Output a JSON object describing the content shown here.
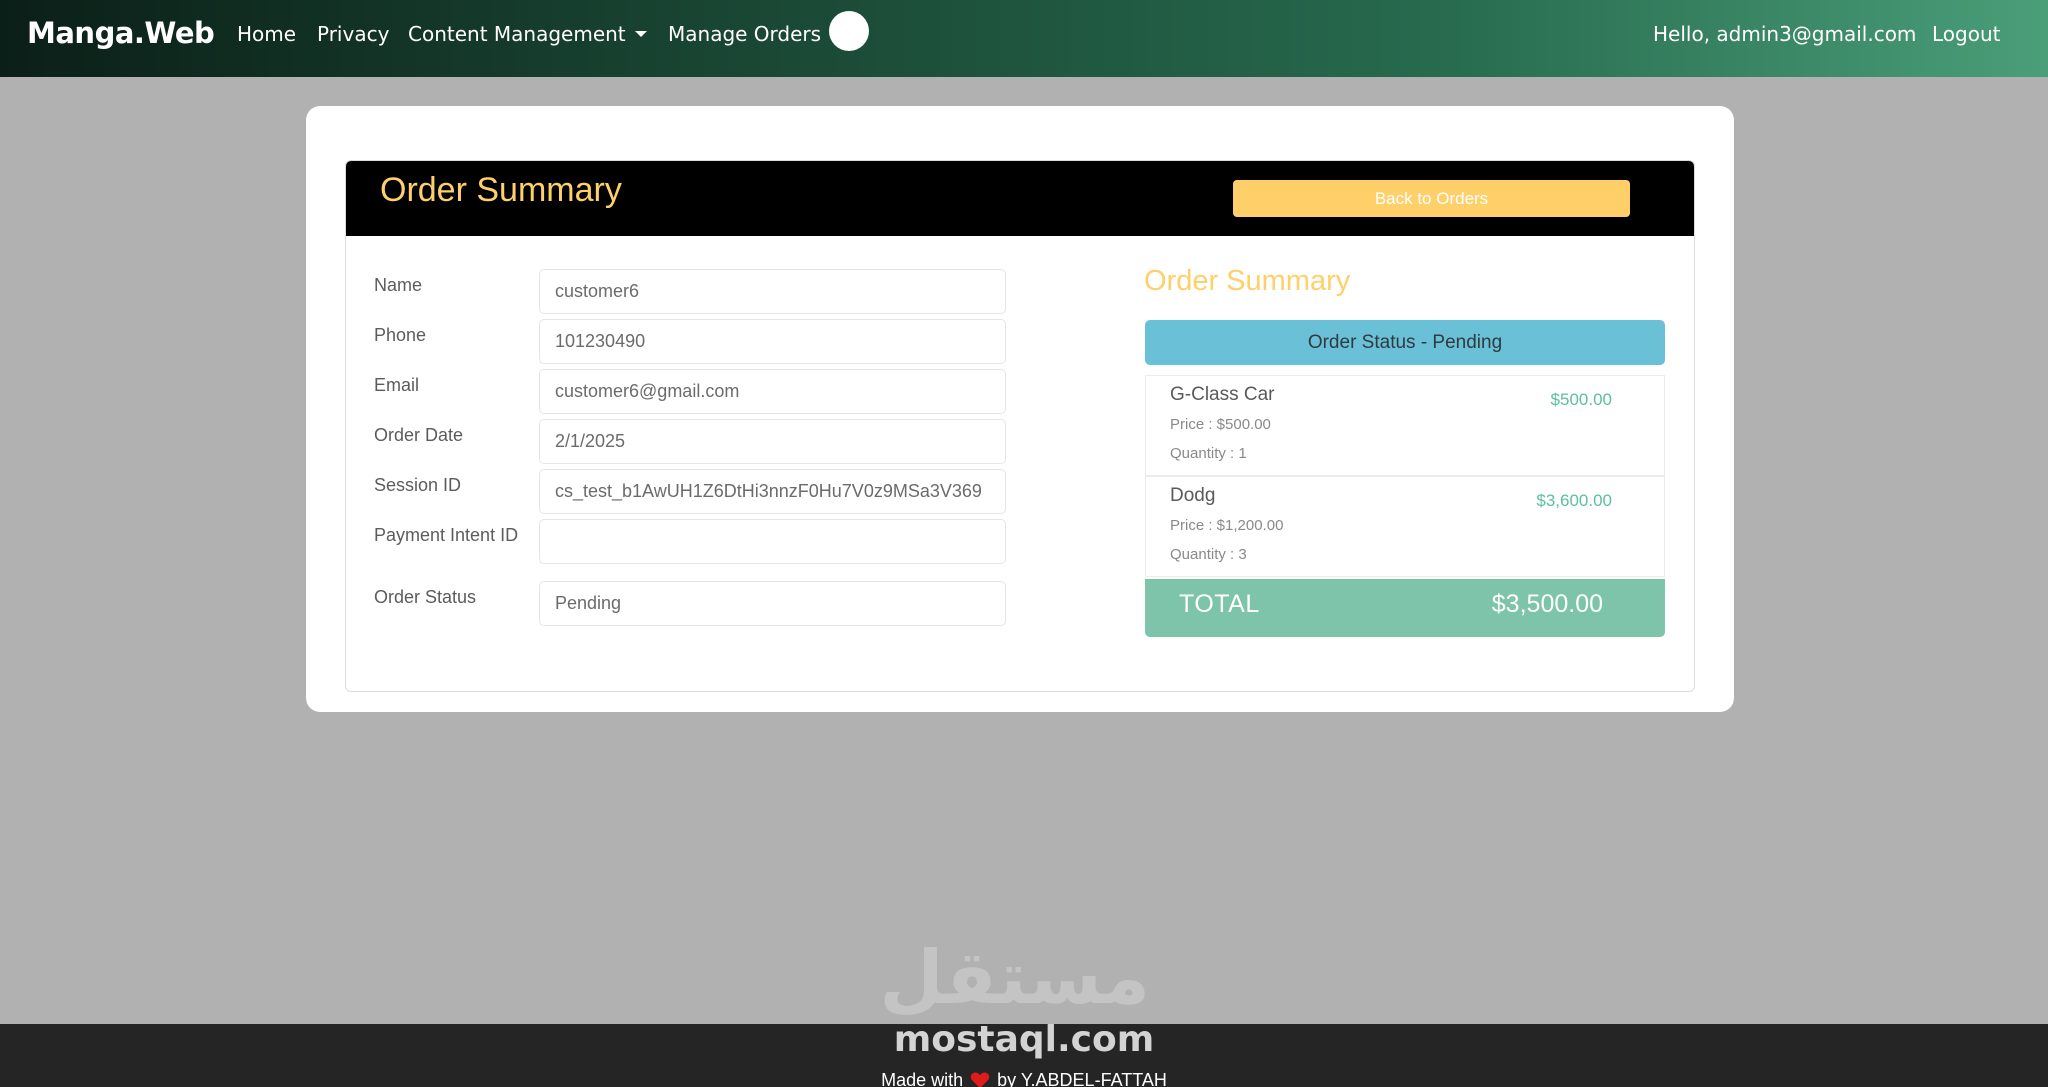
{
  "navbar": {
    "brand": "Manga.Web",
    "links": {
      "home": "Home",
      "privacy": "Privacy",
      "content_management": "Content Management",
      "manage_orders": "Manage Orders"
    },
    "greeting": "Hello, admin3@gmail.com",
    "logout": "Logout"
  },
  "header": {
    "title": "Order Summary",
    "back_button": "Back to Orders"
  },
  "form": {
    "name_label": "Name",
    "name_value": "customer6",
    "phone_label": "Phone",
    "phone_value": "101230490",
    "email_label": "Email",
    "email_value": "customer6@gmail.com",
    "order_date_label": "Order Date",
    "order_date_value": "2/1/2025",
    "session_id_label": "Session ID",
    "session_id_value": "cs_test_b1AwUH1Z6DtHi3nnzF0Hu7V0z9MSa3V369",
    "payment_intent_label": "Payment Intent ID",
    "payment_intent_value": "",
    "order_status_label": "Order Status",
    "order_status_value": "Pending"
  },
  "summary": {
    "title": "Order Summary",
    "status": "Order Status - Pending",
    "items": [
      {
        "name": "G-Class Car",
        "price": "Price : $500.00",
        "quantity": "Quantity : 1",
        "total": "$500.00"
      },
      {
        "name": "Dodg",
        "price": "Price : $1,200.00",
        "quantity": "Quantity : 3",
        "total": "$3,600.00"
      }
    ],
    "total_label": "TOTAL",
    "total_value": "$3,500.00"
  },
  "watermark": {
    "arabic": "مستقل",
    "latin": "mostaql.com"
  },
  "footer": {
    "made_with": "Made with",
    "by": "by Y.ABDEL-FATTAH"
  },
  "colors": {
    "accent_yellow": "#ffd06a",
    "status_blue": "#6ac0d6",
    "total_green": "#7dc4ab",
    "price_green": "#5cc09c",
    "heart_red": "#e01b1b"
  },
  "icons": {
    "heart": "heart-icon",
    "dropdown": "caret-down-icon",
    "avatar": "avatar-circle"
  }
}
